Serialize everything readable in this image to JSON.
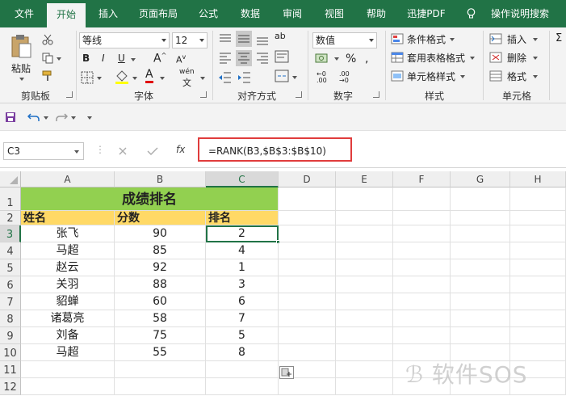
{
  "tabs": [
    {
      "label": "文件",
      "active": false
    },
    {
      "label": "开始",
      "active": true
    },
    {
      "label": "插入",
      "active": false
    },
    {
      "label": "页面布局",
      "active": false
    },
    {
      "label": "公式",
      "active": false
    },
    {
      "label": "数据",
      "active": false
    },
    {
      "label": "审阅",
      "active": false
    },
    {
      "label": "视图",
      "active": false
    },
    {
      "label": "帮助",
      "active": false
    },
    {
      "label": "迅捷PDF",
      "active": false
    }
  ],
  "tell_me": "操作说明搜索",
  "ribbon": {
    "clipboard": {
      "paste": "粘贴",
      "group": "剪贴板"
    },
    "font": {
      "name": "等线",
      "size": "12",
      "phonetic": "wén",
      "group": "字体"
    },
    "alignment": {
      "group": "对齐方式"
    },
    "number": {
      "format": "数值",
      "group": "数字"
    },
    "styles": {
      "conditional": "条件格式",
      "table": "套用表格格式",
      "cell": "单元格样式",
      "group": "样式"
    },
    "cells": {
      "insert": "插入",
      "delete": "删除",
      "format": "格式",
      "group": "单元格"
    }
  },
  "formula_bar": {
    "name_box": "C3",
    "fx": "fx",
    "formula": "=RANK(B3,$B$3:$B$10)"
  },
  "columns": [
    "A",
    "B",
    "C",
    "D",
    "E",
    "F",
    "G",
    "H"
  ],
  "rows": [
    "1",
    "2",
    "3",
    "4",
    "5",
    "6",
    "7",
    "8",
    "9",
    "10",
    "11",
    "12"
  ],
  "sheet": {
    "title": "成绩排名",
    "headers": [
      "姓名",
      "分数",
      "排名"
    ],
    "data": [
      [
        "张飞",
        "90",
        "2"
      ],
      [
        "马超",
        "85",
        "4"
      ],
      [
        "赵云",
        "92",
        "1"
      ],
      [
        "关羽",
        "88",
        "3"
      ],
      [
        "貂蝉",
        "60",
        "6"
      ],
      [
        "诸葛亮",
        "58",
        "7"
      ],
      [
        "刘备",
        "75",
        "5"
      ],
      [
        "马超",
        "55",
        "8"
      ]
    ]
  },
  "watermark": "软件SOS",
  "colors": {
    "brand": "#217346",
    "title_fill": "#92d050",
    "header_fill": "#ffd966",
    "formula_highlight": "#e03c3c"
  }
}
